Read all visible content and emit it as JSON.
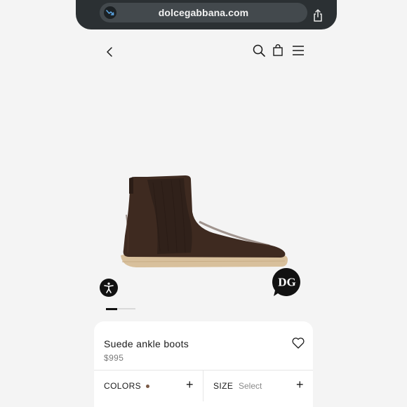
{
  "browser": {
    "url": "dolcegabbana.com",
    "site_icon": "trend-arrow-icon",
    "share_icon": "share-icon"
  },
  "header": {
    "back_icon": "chevron-left-icon",
    "search_icon": "search-icon",
    "bag_icon": "shopping-bag-icon",
    "menu_icon": "hamburger-menu-icon"
  },
  "product": {
    "name": "Suede ankle boots",
    "price": "$995",
    "image": "brown-suede-chelsea-boot",
    "wishlist_icon": "heart-outline-icon",
    "carousel": {
      "current": 1,
      "total": 3
    }
  },
  "options": {
    "colors": {
      "label": "COLORS",
      "swatch_color": "#7a5a46",
      "action": "+"
    },
    "size": {
      "label": "SIZE",
      "value": "Select",
      "action": "+"
    }
  },
  "floating": {
    "accessibility_icon": "accessibility-icon",
    "chat_badge": "DG"
  },
  "colors": {
    "url_bar": "#2b3033",
    "page_bg": "#f4f4f4",
    "boot": "#3e2a20",
    "sole": "#d8c09c"
  }
}
